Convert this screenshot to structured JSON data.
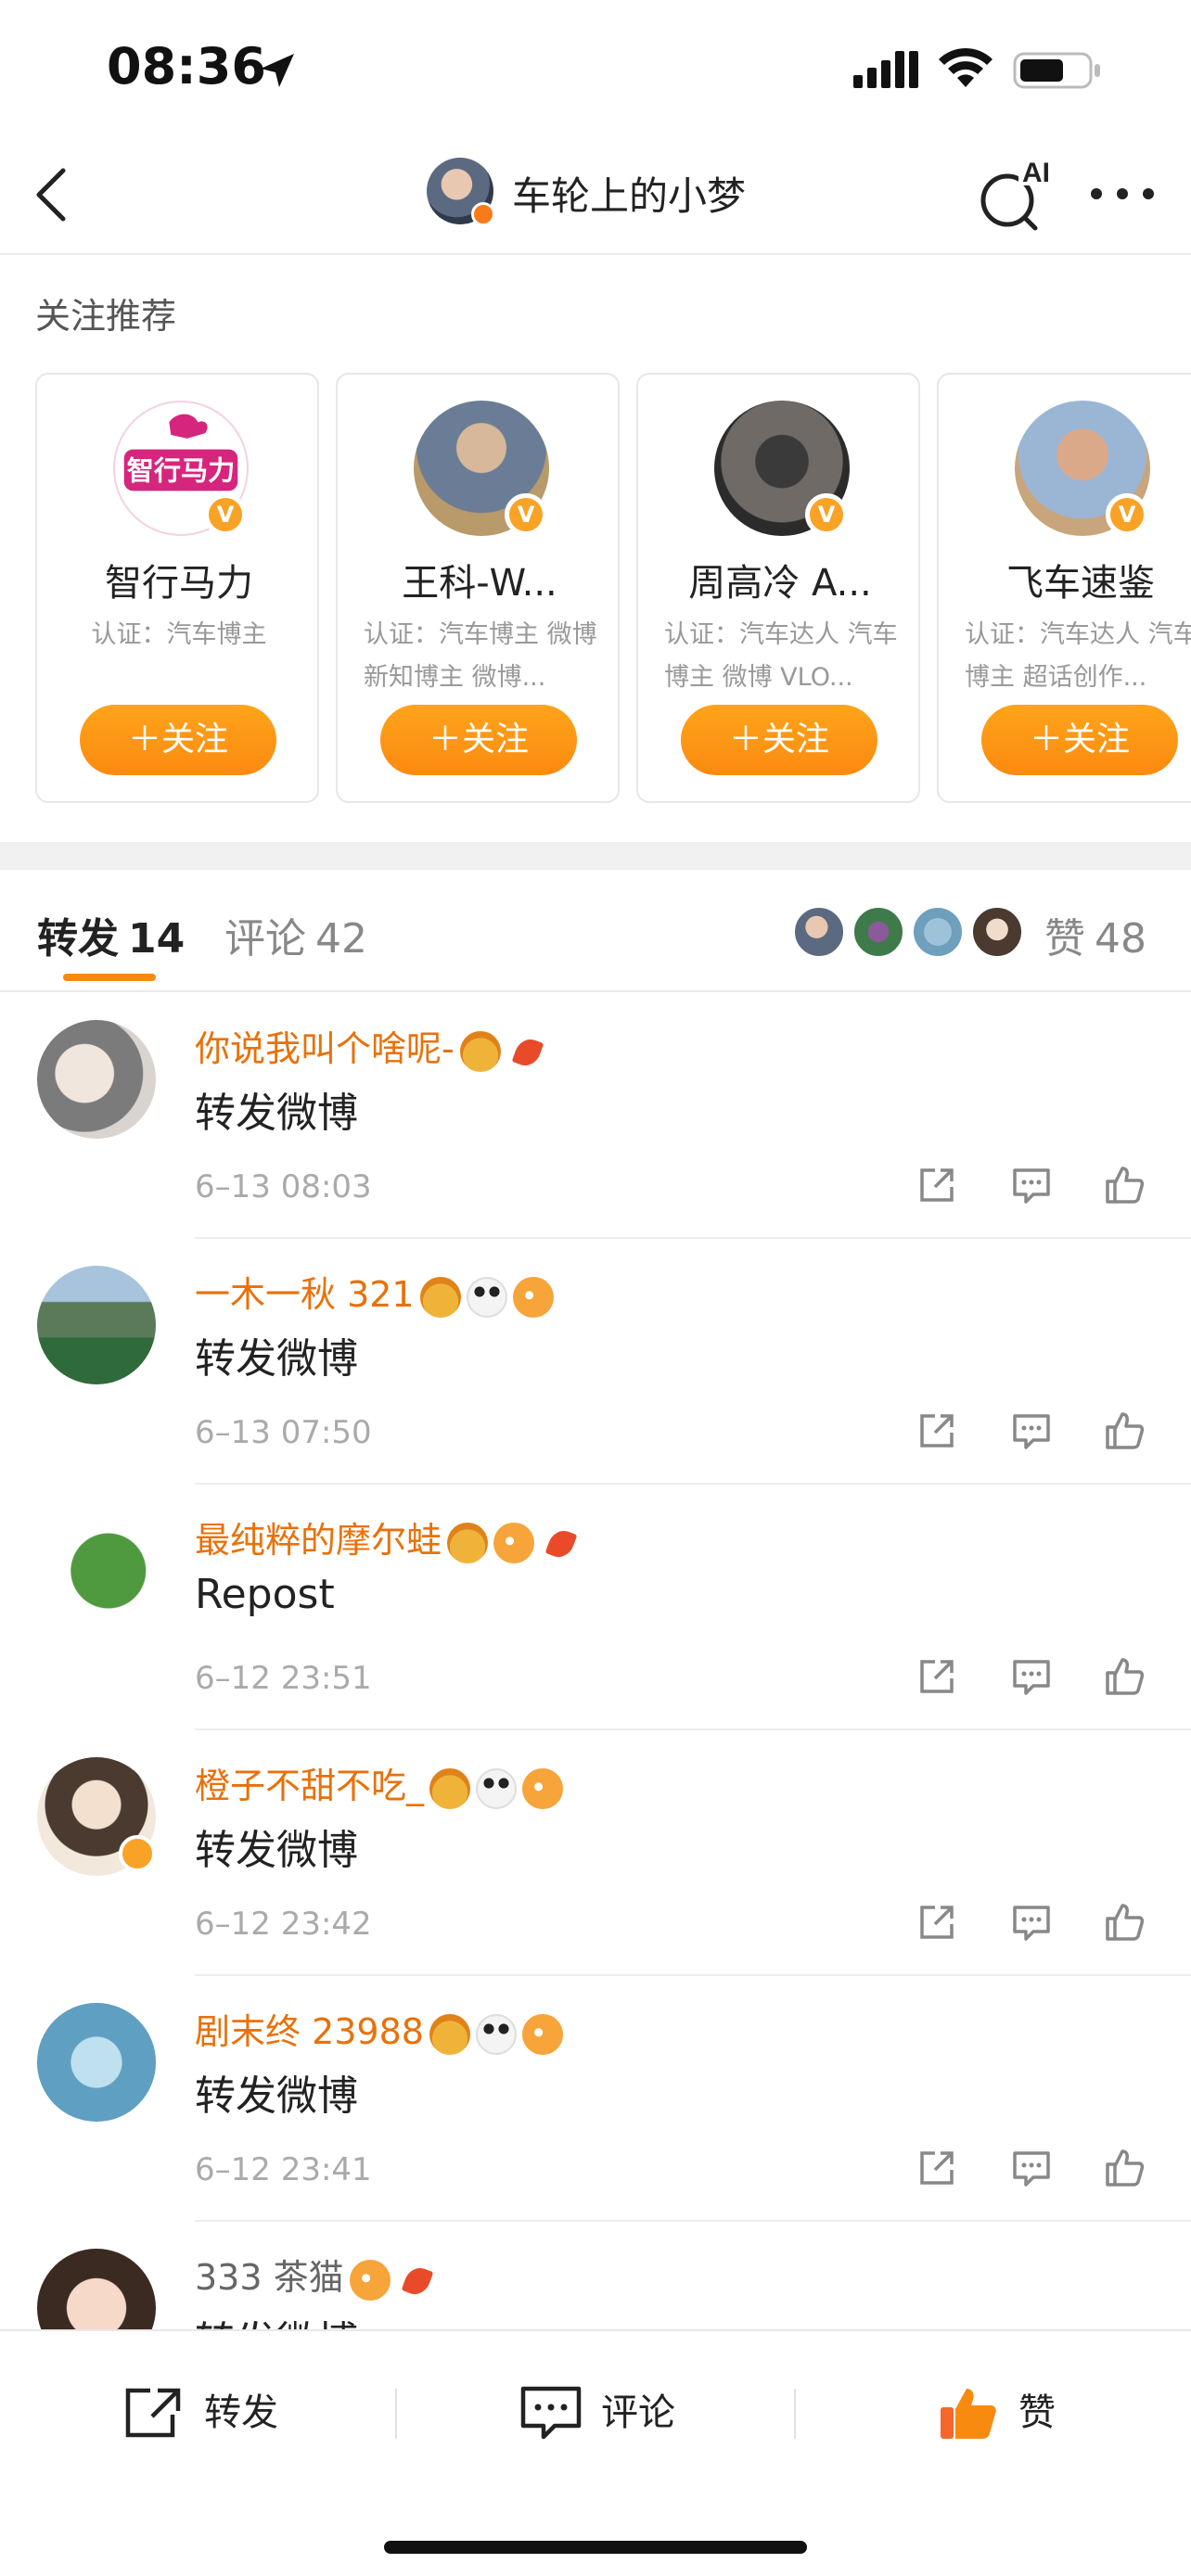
{
  "status": {
    "time": "08:36"
  },
  "nav": {
    "title": "车轮上的小梦",
    "ai_label": "AI"
  },
  "recommend": {
    "title": "关注推荐",
    "cards": [
      {
        "name": "智行马力",
        "desc": "认证：汽车博主",
        "follow": "＋关注",
        "logo_text": "智行马力"
      },
      {
        "name": "王科-W...",
        "desc": "认证：汽车博主 微博新知博主 微博...",
        "follow": "＋关注"
      },
      {
        "name": "周高冷 A...",
        "desc": "认证：汽车达人 汽车博主 微博 VLO...",
        "follow": "＋关注"
      },
      {
        "name": "飞车速鉴",
        "desc": "认证：汽车达人 汽车博主 超话创作...",
        "follow": "＋关注"
      }
    ]
  },
  "tabs": {
    "repost_label": "转发",
    "repost_count": "14",
    "comment_label": "评论",
    "comment_count": "42",
    "like_label": "赞",
    "like_count": "48"
  },
  "reposts": [
    {
      "user": "你说我叫个啥呢-",
      "text": "转发微博",
      "time": "6–13 08:03"
    },
    {
      "user": "一木一秋 321",
      "text": "转发微博",
      "time": "6–13 07:50"
    },
    {
      "user": "最纯粹的摩尔蛙",
      "text": "Repost",
      "time": "6–12 23:51"
    },
    {
      "user": "橙子不甜不吃_",
      "text": "转发微博",
      "time": "6–12 23:42"
    },
    {
      "user": "剧末终 23988",
      "text": "转发微博",
      "time": "6–12 23:41"
    },
    {
      "user": "333 茶猫",
      "text": "转发微博",
      "time": ""
    }
  ],
  "bottom": {
    "repost": "转发",
    "comment": "评论",
    "like": "赞"
  },
  "colors": {
    "accent": "#f98a10",
    "username": "#e8710a",
    "like_active": "#f5672a"
  }
}
